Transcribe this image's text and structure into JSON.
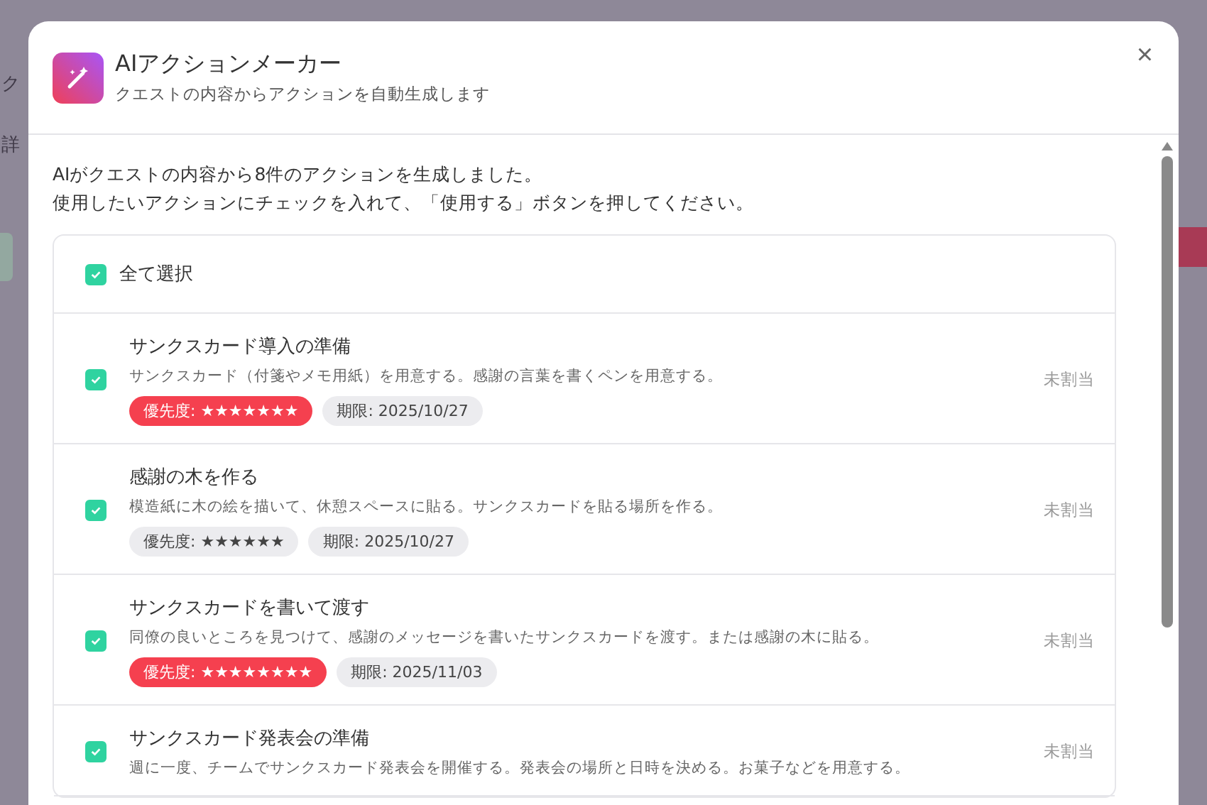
{
  "background": {
    "texts": [
      "ク",
      "詳"
    ]
  },
  "dialog": {
    "title": "AIアクションメーカー",
    "subtitle": "クエストの内容からアクションを自動生成します",
    "close": "×",
    "intro": [
      "AIがクエストの内容から8件のアクションを生成しました。",
      "使用したいアクションにチェックを入れて、「使用する」ボタンを押してください。"
    ],
    "select_all": {
      "label": "全て選択",
      "checked": true
    },
    "actions": [
      {
        "title": "サンクスカード導入の準備",
        "description": "サンクスカード（付箋やメモ用紙）を用意する。感謝の言葉を書くペンを用意する。",
        "priority": "優先度: ★★★★★★★",
        "high": true,
        "deadline": "期限: 2025/10/27",
        "assignee": "未割当",
        "checked": true
      },
      {
        "title": "感謝の木を作る",
        "description": "模造紙に木の絵を描いて、休憩スペースに貼る。サンクスカードを貼る場所を作る。",
        "priority": "優先度: ★★★★★★",
        "high": false,
        "deadline": "期限: 2025/10/27",
        "assignee": "未割当",
        "checked": true
      },
      {
        "title": "サンクスカードを書いて渡す",
        "description": "同僚の良いところを見つけて、感謝のメッセージを書いたサンクスカードを渡す。または感謝の木に貼る。",
        "priority": "優先度: ★★★★★★★★",
        "high": true,
        "deadline": "期限: 2025/11/03",
        "assignee": "未割当",
        "checked": true
      },
      {
        "title": "サンクスカード発表会の準備",
        "description": "週に一度、チームでサンクスカード発表会を開催する。発表会の場所と日時を決める。お菓子などを用意する。",
        "assignee": "未割当",
        "checked": true
      }
    ]
  }
}
